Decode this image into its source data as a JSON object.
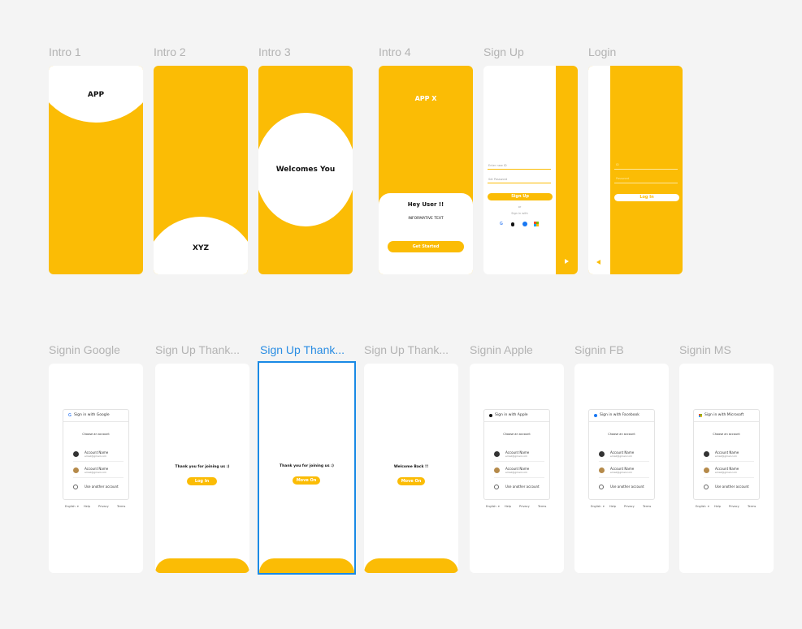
{
  "frames_row1": [
    {
      "label": "Intro 1"
    },
    {
      "label": "Intro 2"
    },
    {
      "label": "Intro 3"
    },
    {
      "label": "Intro 4"
    },
    {
      "label": "Sign Up"
    },
    {
      "label": "Login"
    }
  ],
  "frames_row2": [
    {
      "label": "Signin Google"
    },
    {
      "label": "Sign Up Thank..."
    },
    {
      "label": "Sign Up Thank..."
    },
    {
      "label": "Sign Up Thank..."
    },
    {
      "label": "Signin  Apple"
    },
    {
      "label": "Signin  FB"
    },
    {
      "label": "Signin  MS"
    }
  ],
  "intro1": {
    "title": "APP"
  },
  "intro2": {
    "title": "XYZ"
  },
  "intro3": {
    "title": "Welcomes You"
  },
  "intro4": {
    "brand": "APP X",
    "greeting": "Hey User !!",
    "info": "INFORMATIVE TEXT",
    "cta": "Get Started"
  },
  "signup": {
    "id_placeholder": "Enter new ID",
    "pw_placeholder": "Set Password",
    "button": "Sign Up",
    "or": "or",
    "sign_in_with": "Sign in with"
  },
  "login": {
    "id_placeholder": "ID",
    "pw_placeholder": "Password",
    "button": "Log In"
  },
  "thanks1": {
    "message": "Thank you for joining us :)",
    "button": "Log In"
  },
  "thanks2": {
    "message": "Thank you for joining us :)",
    "button": "Move On"
  },
  "thanks3": {
    "message": "Welcome Back !!",
    "button": "Move On"
  },
  "dialogs": {
    "google": {
      "title": "Sign in with Google"
    },
    "apple": {
      "title": "Sign in with Apple"
    },
    "facebook": {
      "title": "Sign in with Facebook"
    },
    "microsoft": {
      "title": "Sign in with Microsoft"
    },
    "choose": "Choose an account",
    "account_name": "Account Name",
    "account_email": "email@gmail.com",
    "use_another": "Use another account",
    "footer": {
      "lang": "English",
      "help": "Help",
      "privacy": "Privacy",
      "terms": "Terms"
    }
  },
  "colors": {
    "accent": "#fbbc05",
    "selection": "#1a8ae5",
    "canvas": "#f4f4f4"
  }
}
